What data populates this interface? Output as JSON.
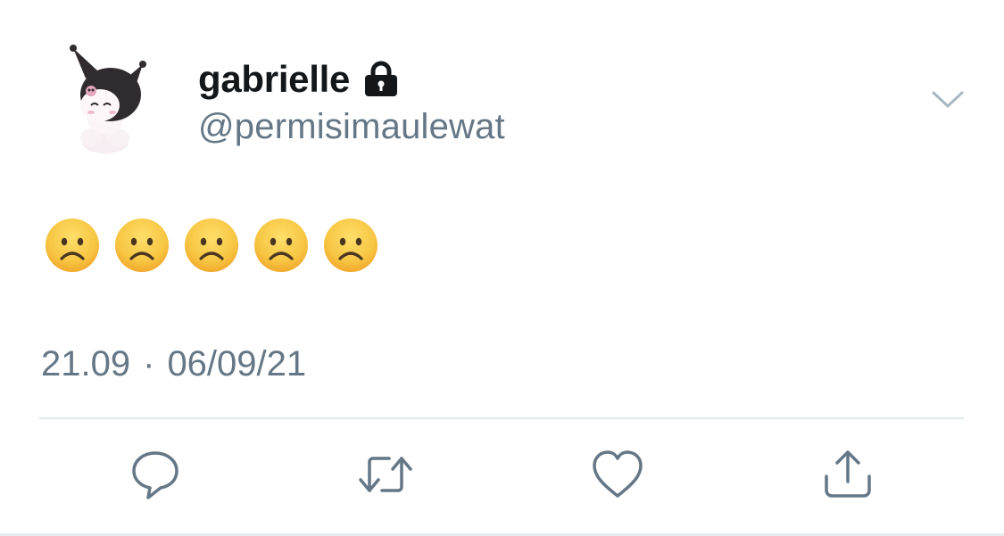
{
  "tweet": {
    "display_name": "gabrielle",
    "handle": "@permisimaulewat",
    "body_emojis": [
      "☹️",
      "☹️",
      "☹️",
      "☹️",
      "☹️"
    ],
    "time": "21.09",
    "separator": "·",
    "date": "06/09/21"
  },
  "icons": {
    "lock": "lock-icon",
    "menu": "chevron-down-icon",
    "reply": "reply-icon",
    "retweet": "retweet-icon",
    "like": "heart-icon",
    "share": "share-icon"
  },
  "colors": {
    "name": "#14171a",
    "secondary": "#657786",
    "divider": "#e1e8ed",
    "emoji_face": "#f7c542"
  }
}
